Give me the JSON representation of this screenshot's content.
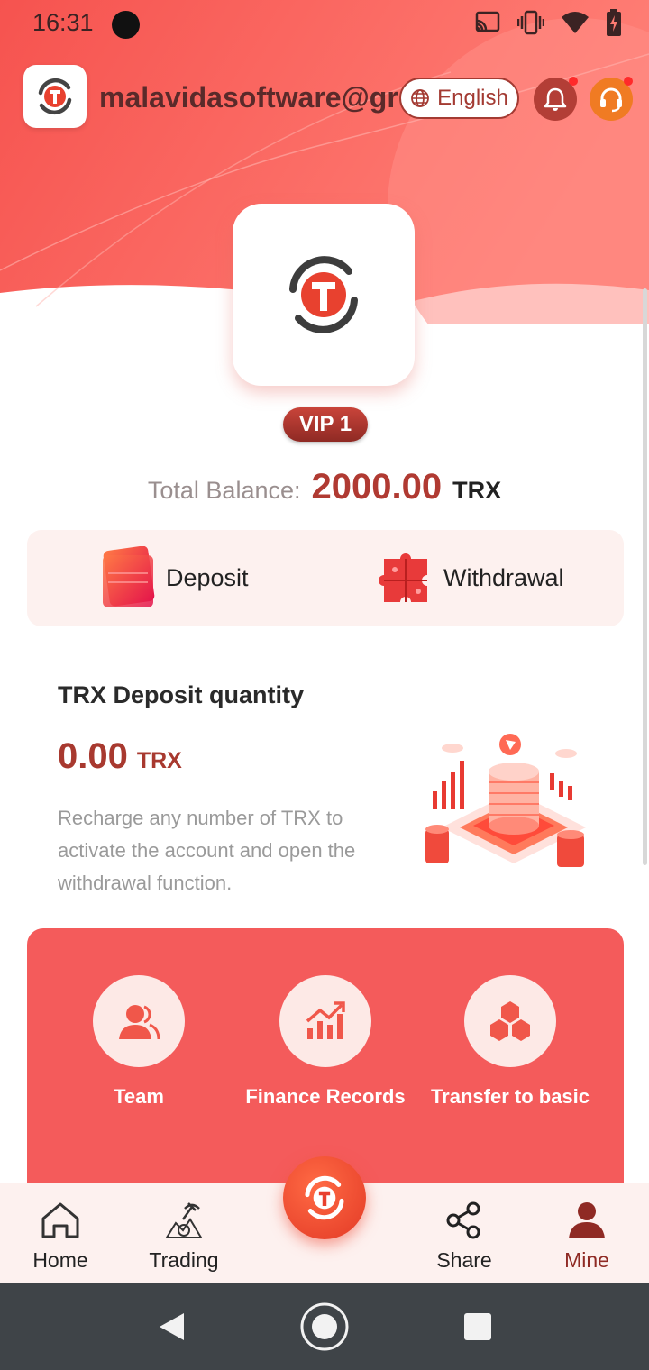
{
  "status_bar": {
    "time": "16:31",
    "icons": [
      "cast-icon",
      "vibrate-icon",
      "wifi-icon",
      "battery-charging-icon"
    ]
  },
  "header": {
    "account_email": "malavidasoftware@gr",
    "language_label": "English",
    "colors": {
      "gradient_start": "#f6534f",
      "gradient_end": "#ff8c86",
      "accent": "#b03a32"
    }
  },
  "profile": {
    "vip_label": "VIP 1"
  },
  "balance": {
    "label": "Total Balance:",
    "value": "2000.00",
    "unit": "TRX"
  },
  "actions": {
    "deposit_label": "Deposit",
    "withdrawal_label": "Withdrawal"
  },
  "deposit_info": {
    "title": "TRX Deposit quantity",
    "quantity": "0.00",
    "unit": "TRX",
    "description": "Recharge any number of TRX to activate the account and open the withdrawal function."
  },
  "features": [
    {
      "label": "Team",
      "icon": "team-icon"
    },
    {
      "label": "Finance Records",
      "icon": "chart-growth-icon"
    },
    {
      "label": "Transfer to basic",
      "icon": "cubes-icon"
    }
  ],
  "bottom_nav": {
    "home": "Home",
    "trading": "Trading",
    "share": "Share",
    "mine": "Mine",
    "active": "mine"
  }
}
